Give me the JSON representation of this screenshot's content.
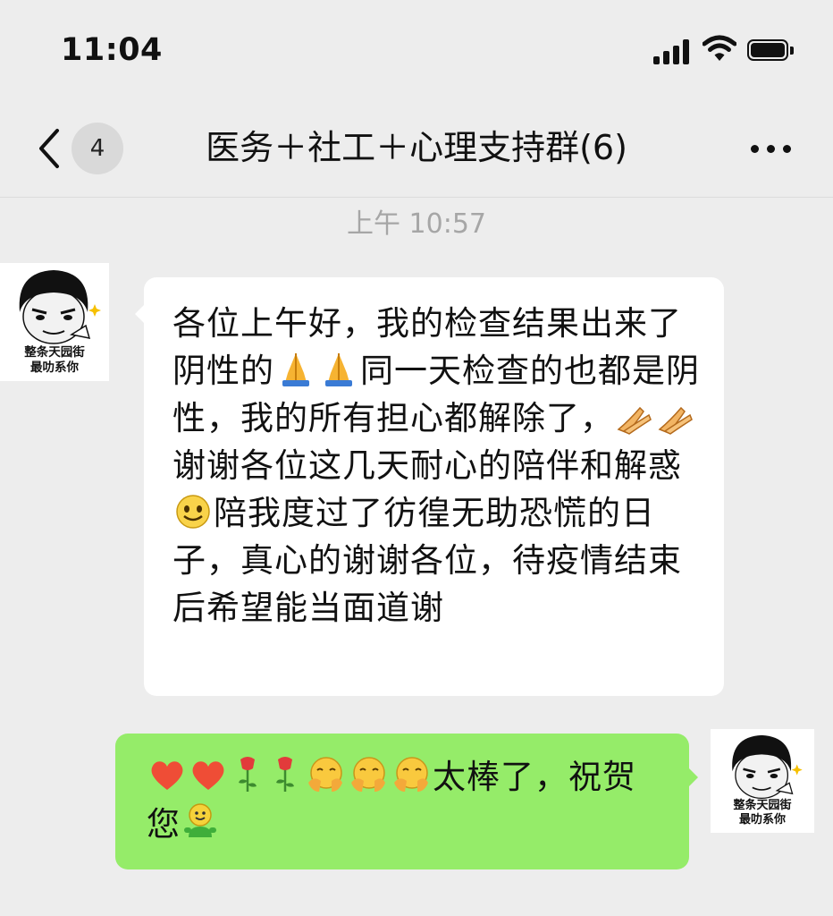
{
  "status_bar": {
    "time": "11:04"
  },
  "nav": {
    "unread_count": "4",
    "title": "医务＋社工＋心理支持群(6)"
  },
  "chat": {
    "timestamp": "上午 10:57",
    "messages": [
      {
        "sender": "other",
        "avatar_caption": [
          "整条天园街",
          "最叻系你"
        ],
        "segments": [
          "各位上午好，我的检查结果出来了阴性的",
          "同一天检查的也都是阴性，我的所有担心都解除了，",
          "谢谢各位这几天耐心的陪伴和解惑",
          "陪我度过了彷徨无助恐慌的日子，真心的谢谢各位，待疫情结束后希望能当面道谢"
        ],
        "emoji": [
          "pray",
          "pray",
          "pray-hands",
          "pray-hands",
          "smile"
        ]
      },
      {
        "sender": "me",
        "avatar_caption": [
          "整条天园街",
          "最叻系你"
        ],
        "segments": [
          "太棒了，祝贺您"
        ],
        "emoji": [
          "heart",
          "heart",
          "rose",
          "rose",
          "hug",
          "hug",
          "hug",
          "grin-figure"
        ]
      }
    ]
  },
  "colors": {
    "background": "#ededed",
    "incoming_bubble": "#ffffff",
    "outgoing_bubble": "#95ec69",
    "timestamp_text": "#a6a6a6"
  }
}
